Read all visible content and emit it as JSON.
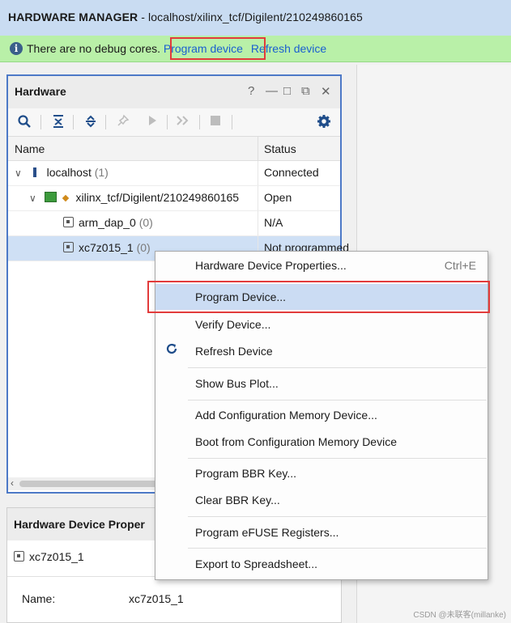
{
  "header": {
    "title_bold": "HARDWARE MANAGER",
    "title_path": " - localhost/xilinx_tcf/Digilent/210249860165"
  },
  "info_bar": {
    "icon": "info-icon",
    "message": "There are no debug cores.",
    "program_link": "Program device",
    "refresh_link": "Refresh device"
  },
  "hw_panel": {
    "title": "Hardware",
    "controls": [
      "?",
      "—",
      "□",
      "⧉",
      "✕"
    ],
    "columns": {
      "name": "Name",
      "status": "Status"
    },
    "rows": [
      {
        "chevron": "∨",
        "label": "localhost",
        "count": "(1)",
        "status": "Connected"
      },
      {
        "chevron": "∨",
        "label": "xilinx_tcf/Digilent/210249860165",
        "status": "Open"
      },
      {
        "label": "arm_dap_0",
        "count": "(0)",
        "status": "N/A"
      },
      {
        "label": "xc7z015_1",
        "count": "(0)",
        "status": "Not programmed"
      }
    ]
  },
  "prop_panel": {
    "title": "Hardware Device Proper",
    "device": "xc7z015_1",
    "name_label": "Name:",
    "name_value": "xc7z015_1"
  },
  "context_menu": {
    "items": [
      {
        "label": "Hardware Device Properties...",
        "shortcut": "Ctrl+E"
      },
      {
        "label": "Program Device..."
      },
      {
        "label": "Verify Device..."
      },
      {
        "label": "Refresh Device",
        "icon": "refresh-icon"
      },
      {
        "label": "Show Bus Plot..."
      },
      {
        "label": "Add Configuration Memory Device..."
      },
      {
        "label": "Boot from Configuration Memory Device"
      },
      {
        "label": "Program BBR Key..."
      },
      {
        "label": "Clear BBR Key..."
      },
      {
        "label": "Program eFUSE Registers..."
      },
      {
        "label": "Export to Spreadsheet..."
      }
    ]
  },
  "watermark": "CSDN @未联客(millanke)"
}
